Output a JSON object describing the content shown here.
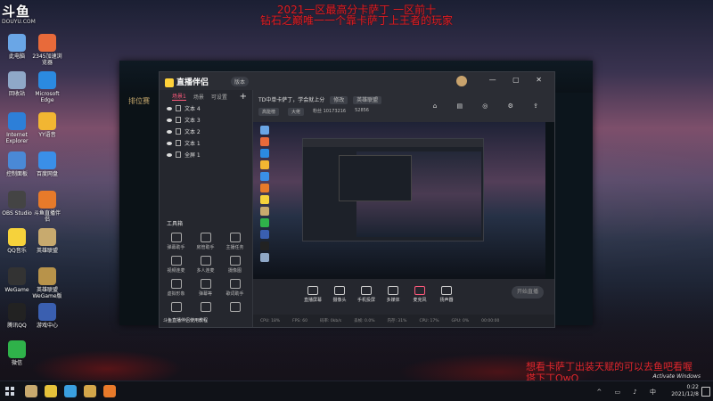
{
  "site_logo": {
    "name": "斗鱼",
    "sub": "DOUYU.COM"
  },
  "overlay": {
    "title_line1": "2021一区最高分卡萨丁 一区前十",
    "title_line2": "钻石之巅唯一一个靠卡萨丁上王者的玩家",
    "bottom_line1": "想看卡萨丁出装天赋的可以去鱼吧看喔",
    "bottom_line2": "塔下丁QwQ"
  },
  "desktop_icons": [
    {
      "label": "此电脑",
      "color": "#6aa6e6"
    },
    {
      "label": "2345加速浏览器",
      "color": "#e86a3a"
    },
    {
      "label": "回收站",
      "color": "#8fa8c8"
    },
    {
      "label": "Microsoft Edge",
      "color": "#2b8ae0"
    },
    {
      "label": "Internet Explorer",
      "color": "#2d7fd8"
    },
    {
      "label": "YY语音",
      "color": "#f2b632"
    },
    {
      "label": "控制面板",
      "color": "#4a89d6"
    },
    {
      "label": "百度网盘",
      "color": "#3a8fe8"
    },
    {
      "label": "OBS Studio",
      "color": "#444"
    },
    {
      "label": "斗鱼直播伴侣",
      "color": "#e77a2a"
    },
    {
      "label": "QQ音乐",
      "color": "#f6d23b"
    },
    {
      "label": "英雄联盟",
      "color": "#c8aa6e"
    },
    {
      "label": "WeGame",
      "color": "#333"
    },
    {
      "label": "英雄联盟WeGame版",
      "color": "#b8934a"
    },
    {
      "label": "腾讯QQ",
      "color": "#222"
    },
    {
      "label": "游戏中心",
      "color": "#3a5fb0"
    },
    {
      "label": "微信",
      "color": "#2fb24a"
    }
  ],
  "lol": {
    "side_label": "排位赛"
  },
  "app": {
    "logo": "直播伴侣",
    "version": "版本",
    "window_controls": "— ▢ ✕",
    "tabs": [
      "场景1",
      "场景",
      "可设置"
    ],
    "scenes": [
      "文本 4",
      "文本 3",
      "文本 2",
      "文本 1",
      "全屏 1"
    ],
    "toolbox_label": "工具箱",
    "tools": [
      "弹幕助手",
      "房管助手",
      "主播任务",
      "视频连麦",
      "多人连麦",
      "摄像图",
      "虚拟形象",
      "弹幕等",
      "歌词助手",
      "",
      "",
      ""
    ],
    "left_footer": "斗鱼直播伴侣使用教程",
    "room_title": "TD中单卡萨丁，学会就上分",
    "room_chip1": "修改",
    "room_chip2": "英雄联盟",
    "stats": [
      "高能榜",
      "大佬",
      "粉丝 10173216",
      "52856"
    ],
    "top_icons": "⌂ ▤ ◎ ⚙ ⇪",
    "controls": [
      "直播屏幕",
      "摄像头",
      "手机投屏",
      "多媒体",
      "麦克风",
      "扬声器"
    ],
    "start_label": "开始直播",
    "status": [
      "CPU: 18%",
      "FPS: 60",
      "码率: 0kb/s",
      "丢帧: 0.0%",
      "内存: 31%",
      "CPU: 17%",
      "GPU: 0%",
      "00:00:00"
    ]
  },
  "taskbar": {
    "apps": [
      "#c8aa6e",
      "#e5c23a",
      "#3aa0e0",
      "#d4a74a",
      "#e87a2a"
    ],
    "tray": "^ ▭ ♪ 中",
    "time": "0:22",
    "date": "2021/12/8"
  },
  "activate_windows": "Activate Windows"
}
